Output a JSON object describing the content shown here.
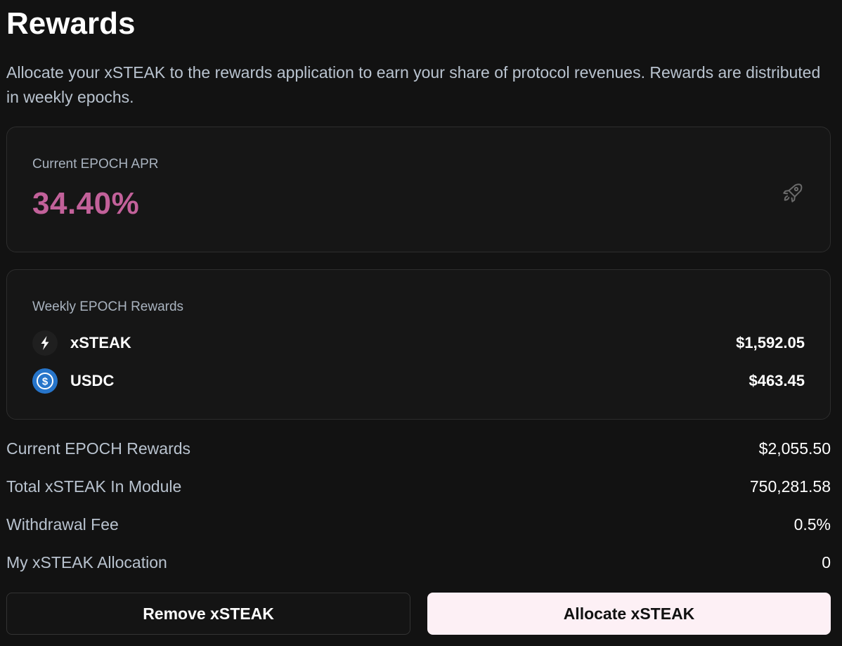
{
  "page": {
    "title": "Rewards",
    "description": "Allocate your xSTEAK to the rewards application to earn your share of protocol revenues. Rewards are distributed in weekly epochs."
  },
  "apr_card": {
    "label": "Current EPOCH APR",
    "value": "34.40%",
    "icon": "rocket-icon",
    "accent_color": "#c2619a"
  },
  "weekly_card": {
    "label": "Weekly EPOCH Rewards",
    "tokens": [
      {
        "name": "xSTEAK",
        "value": "$1,592.05",
        "icon": "xsteak-token-icon"
      },
      {
        "name": "USDC",
        "value": "$463.45",
        "icon": "usdc-token-icon"
      }
    ]
  },
  "stats": [
    {
      "label": "Current EPOCH Rewards",
      "value": "$2,055.50"
    },
    {
      "label": "Total xSTEAK In Module",
      "value": "750,281.58"
    },
    {
      "label": "Withdrawal Fee",
      "value": "0.5%"
    },
    {
      "label": "My xSTEAK Allocation",
      "value": "0"
    }
  ],
  "actions": {
    "remove_label": "Remove xSTEAK",
    "allocate_label": "Allocate xSTEAK"
  }
}
